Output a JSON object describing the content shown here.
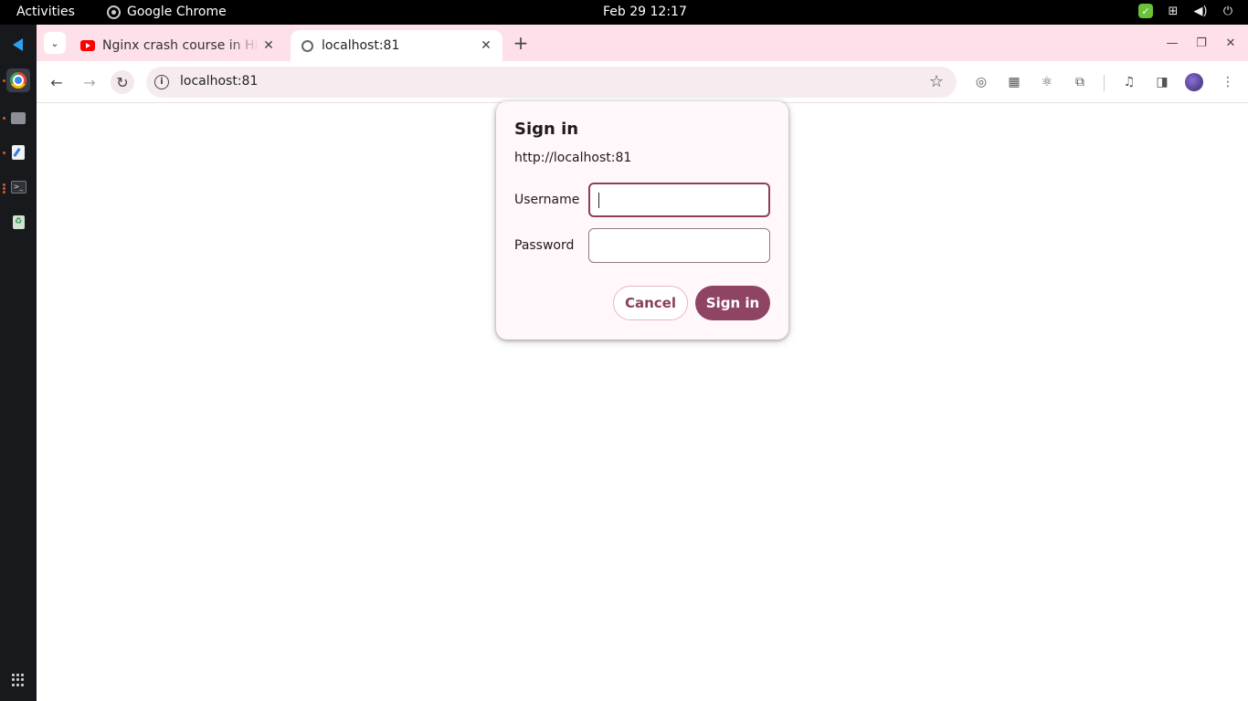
{
  "topbar": {
    "activities": "Activities",
    "app_name": "Google Chrome",
    "clock": "Feb 29  12:17"
  },
  "dock": {
    "apps": [
      "vscode-icon",
      "chrome-icon",
      "files-icon",
      "text-editor-icon",
      "terminal-icon",
      "trash-icon",
      "app-grid-icon"
    ]
  },
  "browser": {
    "tabs": [
      {
        "title": "Nginx crash course in Hi",
        "favicon": "youtube-icon",
        "active": false
      },
      {
        "title": "localhost:81",
        "favicon": "globe-icon",
        "active": true
      }
    ],
    "address": "localhost:81"
  },
  "auth_dialog": {
    "title": "Sign in",
    "origin": "http://localhost:81",
    "username_label": "Username",
    "username_value": "",
    "password_label": "Password",
    "password_value": "",
    "cancel_label": "Cancel",
    "signin_label": "Sign in"
  },
  "colors": {
    "accent": "#8e4462",
    "tabstrip": "#fde0ea",
    "dialog_bg": "#fff7fa"
  }
}
